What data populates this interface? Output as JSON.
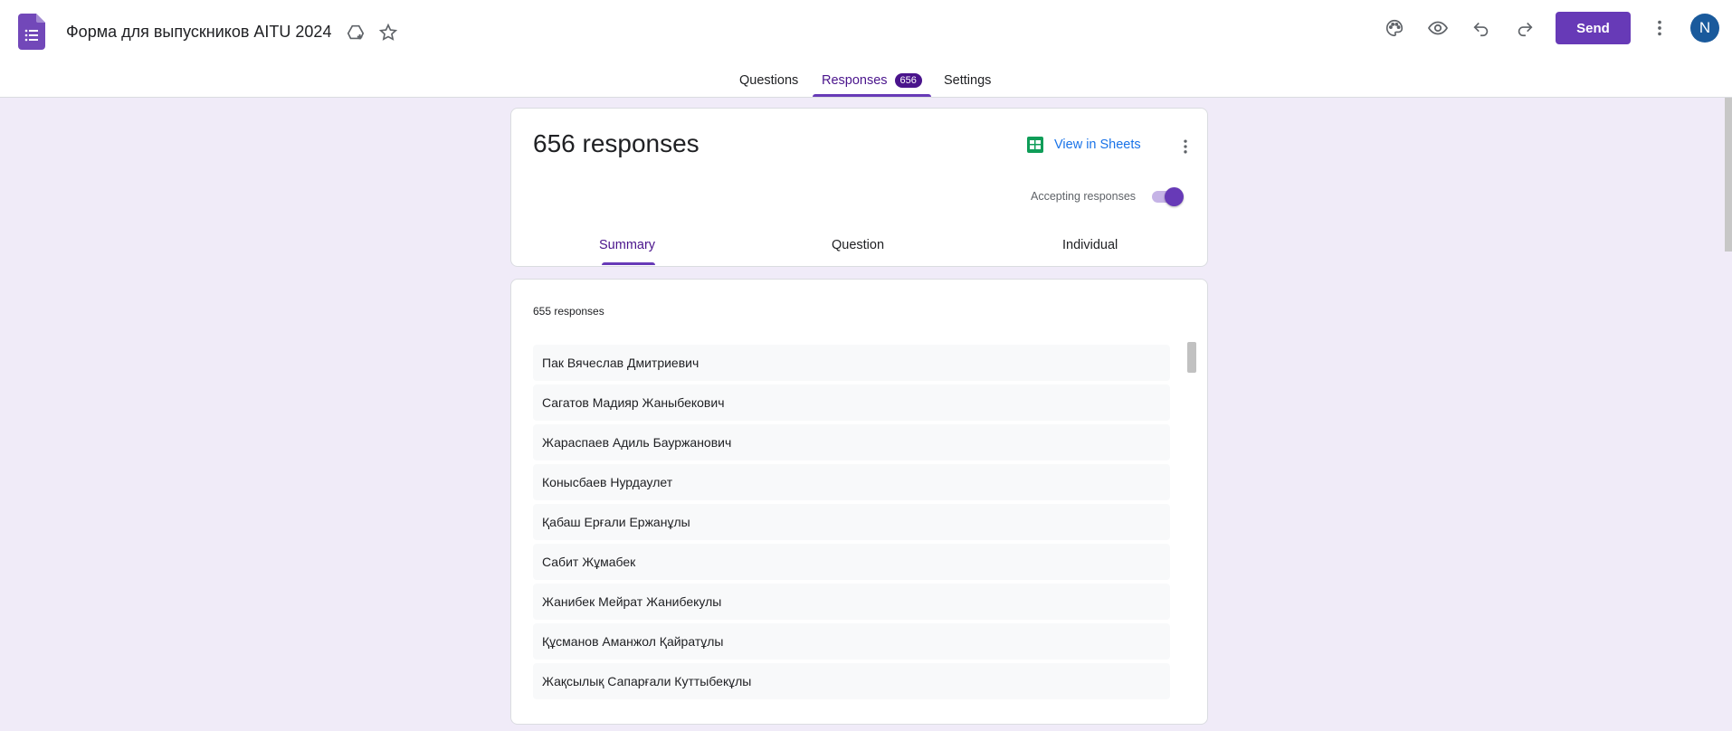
{
  "header": {
    "title": "Форма для выпускников AITU 2024",
    "send_label": "Send",
    "avatar_letter": "N",
    "tabs": [
      {
        "label": "Questions"
      },
      {
        "label": "Responses",
        "badge": "656"
      },
      {
        "label": "Settings"
      }
    ],
    "colors": {
      "accent": "#673ab7",
      "accent_dark": "#4a148c",
      "background": "#f0ebf8"
    }
  },
  "summary_card": {
    "response_count": "656 responses",
    "view_in_sheets": "View in Sheets",
    "accepting_label": "Accepting responses",
    "accepting_on": true,
    "subtabs": [
      "Summary",
      "Question",
      "Individual"
    ]
  },
  "question_card": {
    "count_label": "655 responses",
    "items": [
      "Пак Вячеслав Дмитриевич",
      "Сагатов Мадияр Жаныбекович",
      "Жараспаев Адиль Бауржанович",
      "Конысбаев Нурдаулет",
      "Қабаш Ерғали Ержанұлы",
      "Сабит Жұмабек",
      "Жанибек Мейрат Жанибекулы",
      "Құсманов Аманжол Қайратұлы",
      "Жақсылық Сапарғали Куттыбекұлы"
    ]
  }
}
